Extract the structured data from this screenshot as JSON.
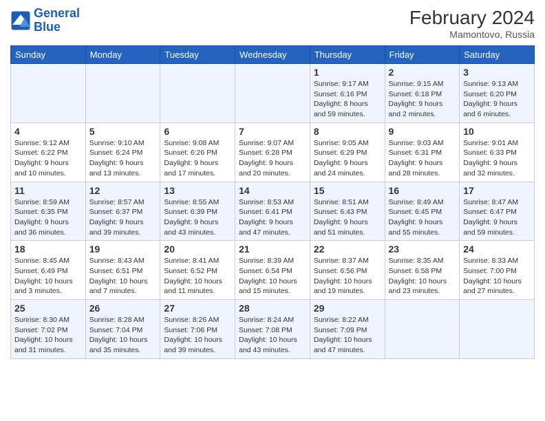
{
  "header": {
    "logo_line1": "General",
    "logo_line2": "Blue",
    "month": "February 2024",
    "location": "Mamontovo, Russia"
  },
  "days_of_week": [
    "Sunday",
    "Monday",
    "Tuesday",
    "Wednesday",
    "Thursday",
    "Friday",
    "Saturday"
  ],
  "weeks": [
    [
      {
        "day": "",
        "info": ""
      },
      {
        "day": "",
        "info": ""
      },
      {
        "day": "",
        "info": ""
      },
      {
        "day": "",
        "info": ""
      },
      {
        "day": "1",
        "info": "Sunrise: 9:17 AM\nSunset: 6:16 PM\nDaylight: 8 hours and 59 minutes."
      },
      {
        "day": "2",
        "info": "Sunrise: 9:15 AM\nSunset: 6:18 PM\nDaylight: 9 hours and 2 minutes."
      },
      {
        "day": "3",
        "info": "Sunrise: 9:13 AM\nSunset: 6:20 PM\nDaylight: 9 hours and 6 minutes."
      }
    ],
    [
      {
        "day": "4",
        "info": "Sunrise: 9:12 AM\nSunset: 6:22 PM\nDaylight: 9 hours and 10 minutes."
      },
      {
        "day": "5",
        "info": "Sunrise: 9:10 AM\nSunset: 6:24 PM\nDaylight: 9 hours and 13 minutes."
      },
      {
        "day": "6",
        "info": "Sunrise: 9:08 AM\nSunset: 6:26 PM\nDaylight: 9 hours and 17 minutes."
      },
      {
        "day": "7",
        "info": "Sunrise: 9:07 AM\nSunset: 6:28 PM\nDaylight: 9 hours and 20 minutes."
      },
      {
        "day": "8",
        "info": "Sunrise: 9:05 AM\nSunset: 6:29 PM\nDaylight: 9 hours and 24 minutes."
      },
      {
        "day": "9",
        "info": "Sunrise: 9:03 AM\nSunset: 6:31 PM\nDaylight: 9 hours and 28 minutes."
      },
      {
        "day": "10",
        "info": "Sunrise: 9:01 AM\nSunset: 6:33 PM\nDaylight: 9 hours and 32 minutes."
      }
    ],
    [
      {
        "day": "11",
        "info": "Sunrise: 8:59 AM\nSunset: 6:35 PM\nDaylight: 9 hours and 36 minutes."
      },
      {
        "day": "12",
        "info": "Sunrise: 8:57 AM\nSunset: 6:37 PM\nDaylight: 9 hours and 39 minutes."
      },
      {
        "day": "13",
        "info": "Sunrise: 8:55 AM\nSunset: 6:39 PM\nDaylight: 9 hours and 43 minutes."
      },
      {
        "day": "14",
        "info": "Sunrise: 8:53 AM\nSunset: 6:41 PM\nDaylight: 9 hours and 47 minutes."
      },
      {
        "day": "15",
        "info": "Sunrise: 8:51 AM\nSunset: 6:43 PM\nDaylight: 9 hours and 51 minutes."
      },
      {
        "day": "16",
        "info": "Sunrise: 8:49 AM\nSunset: 6:45 PM\nDaylight: 9 hours and 55 minutes."
      },
      {
        "day": "17",
        "info": "Sunrise: 8:47 AM\nSunset: 6:47 PM\nDaylight: 9 hours and 59 minutes."
      }
    ],
    [
      {
        "day": "18",
        "info": "Sunrise: 8:45 AM\nSunset: 6:49 PM\nDaylight: 10 hours and 3 minutes."
      },
      {
        "day": "19",
        "info": "Sunrise: 8:43 AM\nSunset: 6:51 PM\nDaylight: 10 hours and 7 minutes."
      },
      {
        "day": "20",
        "info": "Sunrise: 8:41 AM\nSunset: 6:52 PM\nDaylight: 10 hours and 11 minutes."
      },
      {
        "day": "21",
        "info": "Sunrise: 8:39 AM\nSunset: 6:54 PM\nDaylight: 10 hours and 15 minutes."
      },
      {
        "day": "22",
        "info": "Sunrise: 8:37 AM\nSunset: 6:56 PM\nDaylight: 10 hours and 19 minutes."
      },
      {
        "day": "23",
        "info": "Sunrise: 8:35 AM\nSunset: 6:58 PM\nDaylight: 10 hours and 23 minutes."
      },
      {
        "day": "24",
        "info": "Sunrise: 8:33 AM\nSunset: 7:00 PM\nDaylight: 10 hours and 27 minutes."
      }
    ],
    [
      {
        "day": "25",
        "info": "Sunrise: 8:30 AM\nSunset: 7:02 PM\nDaylight: 10 hours and 31 minutes."
      },
      {
        "day": "26",
        "info": "Sunrise: 8:28 AM\nSunset: 7:04 PM\nDaylight: 10 hours and 35 minutes."
      },
      {
        "day": "27",
        "info": "Sunrise: 8:26 AM\nSunset: 7:06 PM\nDaylight: 10 hours and 39 minutes."
      },
      {
        "day": "28",
        "info": "Sunrise: 8:24 AM\nSunset: 7:08 PM\nDaylight: 10 hours and 43 minutes."
      },
      {
        "day": "29",
        "info": "Sunrise: 8:22 AM\nSunset: 7:09 PM\nDaylight: 10 hours and 47 minutes."
      },
      {
        "day": "",
        "info": ""
      },
      {
        "day": "",
        "info": ""
      }
    ]
  ]
}
